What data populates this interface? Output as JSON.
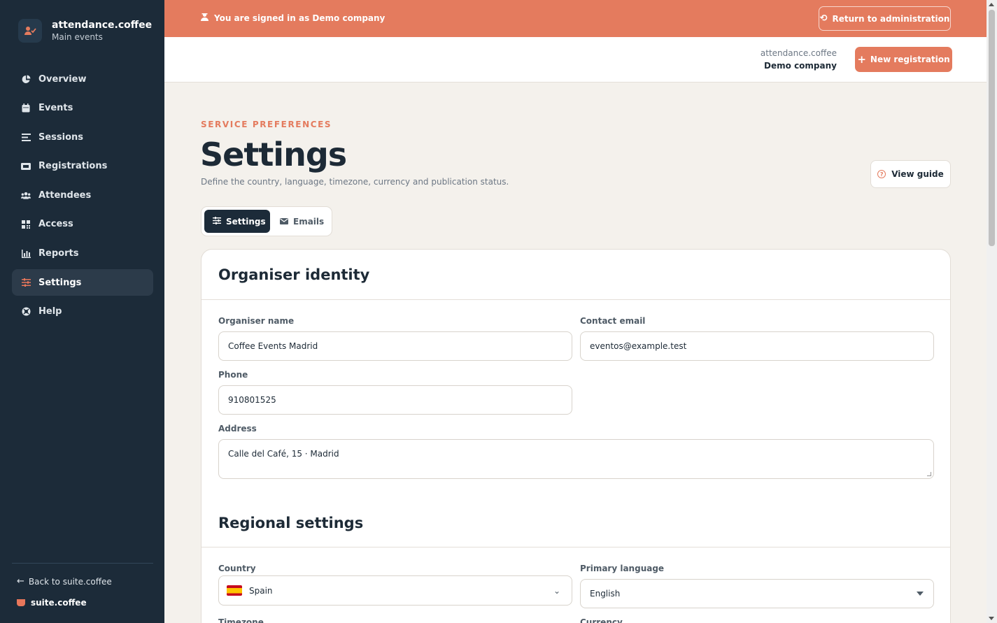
{
  "sidebar": {
    "brand_title": "attendance.coffee",
    "brand_subtitle": "Main events",
    "items": [
      {
        "label": "Overview",
        "icon": "pie-chart-icon"
      },
      {
        "label": "Events",
        "icon": "calendar-icon"
      },
      {
        "label": "Sessions",
        "icon": "list-icon"
      },
      {
        "label": "Registrations",
        "icon": "ticket-icon"
      },
      {
        "label": "Attendees",
        "icon": "users-icon"
      },
      {
        "label": "Access",
        "icon": "qr-code-icon"
      },
      {
        "label": "Reports",
        "icon": "bar-chart-icon"
      },
      {
        "label": "Settings",
        "icon": "sliders-icon",
        "active": true
      },
      {
        "label": "Help",
        "icon": "lifebuoy-icon"
      }
    ],
    "back_label": "Back to suite.coffee",
    "suite_label": "suite.coffee"
  },
  "banner": {
    "message": "You are signed in as Demo company",
    "return_label": "Return to administration"
  },
  "header": {
    "app_name": "attendance.coffee",
    "company": "Demo company",
    "new_registration_label": "New registration"
  },
  "page": {
    "eyebrow": "SERVICE PREFERENCES",
    "title": "Settings",
    "subtitle": "Define the country, language, timezone, currency and publication status.",
    "view_guide_label": "View guide"
  },
  "tabs": {
    "settings": "Settings",
    "emails": "Emails"
  },
  "organiser": {
    "section_title": "Organiser identity",
    "name_label": "Organiser name",
    "name_value": "Coffee Events Madrid",
    "email_label": "Contact email",
    "email_value": "eventos@example.test",
    "phone_label": "Phone",
    "phone_value": "910801525",
    "address_label": "Address",
    "address_value": "Calle del Café, 15 · Madrid"
  },
  "regional": {
    "section_title": "Regional settings",
    "country_label": "Country",
    "country_value": "Spain",
    "language_label": "Primary language",
    "language_value": "English",
    "timezone_label": "Timezone",
    "currency_label": "Currency"
  },
  "colors": {
    "accent": "#e47b5e",
    "sidebar_bg": "#1c2b39",
    "page_bg": "#f4f1ec"
  }
}
